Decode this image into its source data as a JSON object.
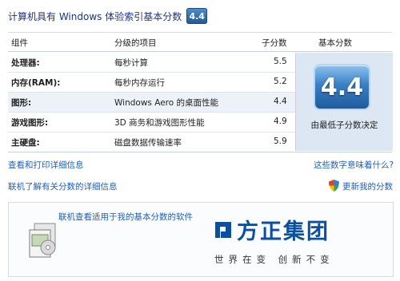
{
  "header": {
    "title": "计算机具有 Windows 体验索引基本分数",
    "badge": "4.4"
  },
  "columns": {
    "component": "组件",
    "item": "分级的项目",
    "subscore": "子分数",
    "basescore": "基本分数"
  },
  "rows": [
    {
      "component": "处理器:",
      "item": "每秒计算",
      "score": "5.5"
    },
    {
      "component": "内存(RAM):",
      "item": "每秒内存运行",
      "score": "5.2"
    },
    {
      "component": "图形:",
      "item": "Windows Aero 的桌面性能",
      "score": "4.4"
    },
    {
      "component": "游戏图形:",
      "item": "3D 商务和游戏图形性能",
      "score": "4.9"
    },
    {
      "component": "主硬盘:",
      "item": "磁盘数据传输速率",
      "score": "5.9"
    }
  ],
  "base": {
    "score": "4.4",
    "note": "由最低子分数决定"
  },
  "links": {
    "view_print": "查看和打印详细信息",
    "what_mean": "这些数字意味着什么?",
    "online_learn": "联机了解有关分数的详细信息",
    "update": "更新我的分数",
    "online_software": "联机查看适用于我的基本分数的软件"
  },
  "brand": {
    "name": "方正集团",
    "slogan": "世界在变 创新不变"
  },
  "colors": {
    "link": "#1b5fbf",
    "header_text": "#1e3287",
    "badge": "#2f6fb2",
    "brand": "#0a4fa0"
  }
}
